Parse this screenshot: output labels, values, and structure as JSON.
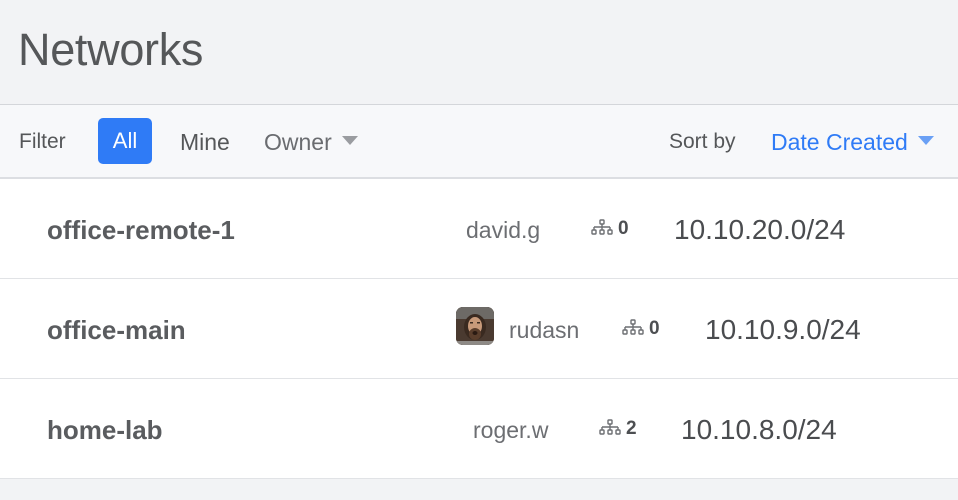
{
  "header": {
    "title": "Networks"
  },
  "filter": {
    "label": "Filter",
    "options": {
      "all": "All",
      "mine": "Mine",
      "owner": "Owner"
    },
    "active": "All",
    "active_color": "#2f7bf6"
  },
  "sort": {
    "label": "Sort by",
    "value": "Date Created"
  },
  "icons": {
    "members": "network-members-icon",
    "caret": "caret-down-icon"
  },
  "networks": [
    {
      "name": "office-remote-1",
      "owner": "david.g",
      "has_avatar": false,
      "members": "0",
      "cidr": "10.10.20.0/24"
    },
    {
      "name": "office-main",
      "owner": "rudasn",
      "has_avatar": true,
      "members": "0",
      "cidr": "10.10.9.0/24"
    },
    {
      "name": "home-lab",
      "owner": "roger.w",
      "has_avatar": false,
      "members": "2",
      "cidr": "10.10.8.0/24"
    }
  ]
}
